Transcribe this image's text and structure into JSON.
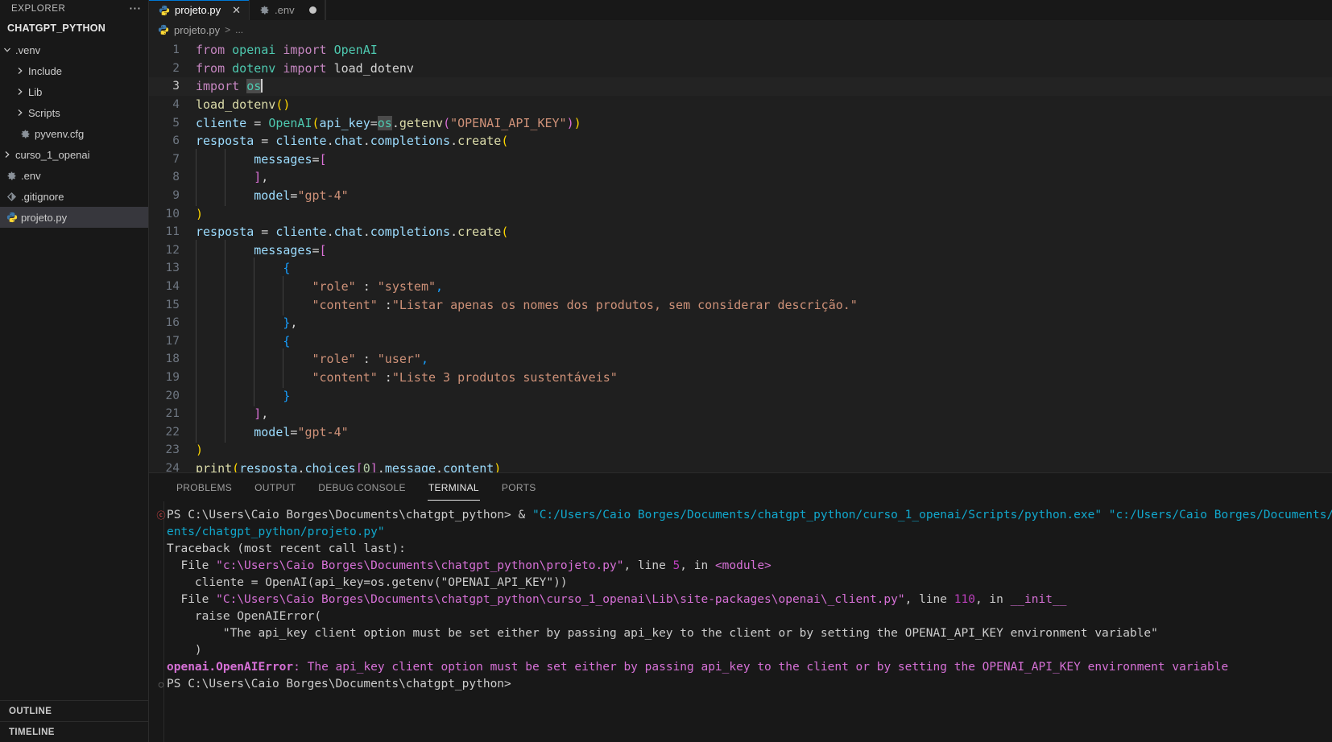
{
  "sidebar": {
    "header_title": "EXPLORER",
    "more_icon": "ellipsis-icon",
    "root_folder": "CHATGPT_PYTHON",
    "items": [
      {
        "label": ".venv",
        "type": "folder",
        "expanded": true,
        "indent": 0,
        "icon": "chevron-down-icon"
      },
      {
        "label": "Include",
        "type": "folder",
        "expanded": false,
        "indent": 1,
        "icon": "chevron-right-icon"
      },
      {
        "label": "Lib",
        "type": "folder",
        "expanded": false,
        "indent": 1,
        "icon": "chevron-right-icon"
      },
      {
        "label": "Scripts",
        "type": "folder",
        "expanded": false,
        "indent": 1,
        "icon": "chevron-right-icon"
      },
      {
        "label": "pyvenv.cfg",
        "type": "file",
        "indent": 1,
        "icon": "gear-icon"
      },
      {
        "label": "curso_1_openai",
        "type": "folder",
        "expanded": false,
        "indent": 0,
        "icon": "chevron-right-icon"
      },
      {
        "label": ".env",
        "type": "file",
        "indent": 0,
        "icon": "gear-icon"
      },
      {
        "label": ".gitignore",
        "type": "file",
        "indent": 0,
        "icon": "git-icon"
      },
      {
        "label": "projeto.py",
        "type": "file",
        "indent": 0,
        "icon": "python-icon",
        "selected": true
      }
    ],
    "bottom_sections": [
      {
        "label": "OUTLINE"
      },
      {
        "label": "TIMELINE"
      }
    ]
  },
  "tabs": [
    {
      "label": "projeto.py",
      "icon": "python-icon",
      "active": true,
      "close_icon": "close-icon"
    },
    {
      "label": ".env",
      "icon": "gear-icon",
      "active": false,
      "dirty_icon": "dirty-dot-icon"
    }
  ],
  "breadcrumb": {
    "file": "projeto.py",
    "separator": ">",
    "tail": "...",
    "icon": "python-icon"
  },
  "editor": {
    "active_line": 3,
    "cursor_line": 3,
    "lines": [
      {
        "n": 1,
        "text": "from openai import OpenAI"
      },
      {
        "n": 2,
        "text": "from dotenv import load_dotenv"
      },
      {
        "n": 3,
        "text": "import os"
      },
      {
        "n": 4,
        "text": "load_dotenv()"
      },
      {
        "n": 5,
        "text": "cliente = OpenAI(api_key=os.getenv(\"OPENAI_API_KEY\"))"
      },
      {
        "n": 6,
        "text": "resposta = cliente.chat.completions.create("
      },
      {
        "n": 7,
        "text": "        messages=["
      },
      {
        "n": 8,
        "text": "        ],"
      },
      {
        "n": 9,
        "text": "        model=\"gpt-4\""
      },
      {
        "n": 10,
        "text": ")"
      },
      {
        "n": 11,
        "text": "resposta = cliente.chat.completions.create("
      },
      {
        "n": 12,
        "text": "        messages=["
      },
      {
        "n": 13,
        "text": "            {"
      },
      {
        "n": 14,
        "text": "                \"role\" : \"system\","
      },
      {
        "n": 15,
        "text": "                \"content\" :\"Listar apenas os nomes dos produtos, sem considerar descrição.\""
      },
      {
        "n": 16,
        "text": "            },"
      },
      {
        "n": 17,
        "text": "            {"
      },
      {
        "n": 18,
        "text": "                \"role\" : \"user\","
      },
      {
        "n": 19,
        "text": "                \"content\" :\"Liste 3 produtos sustentáveis\""
      },
      {
        "n": 20,
        "text": "            }"
      },
      {
        "n": 21,
        "text": "        ],"
      },
      {
        "n": 22,
        "text": "        model=\"gpt-4\""
      },
      {
        "n": 23,
        "text": ")"
      },
      {
        "n": 24,
        "text": "print(resposta.choices[0].message.content)"
      }
    ]
  },
  "panel": {
    "tabs": [
      {
        "label": "PROBLEMS",
        "active": false
      },
      {
        "label": "OUTPUT",
        "active": false
      },
      {
        "label": "DEBUG CONSOLE",
        "active": false
      },
      {
        "label": "TERMINAL",
        "active": true
      },
      {
        "label": "PORTS",
        "active": false
      }
    ],
    "terminal": {
      "prompt_1": "PS C:\\Users\\Caio Borges\\Documents\\chatgpt_python>",
      "command_amp": " & ",
      "command_python": "\"C:/Users/Caio Borges/Documents/chatgpt_python/curso_1_openai/Scripts/python.exe\"",
      "command_script": " \"c:/Users/Caio Borges/Documents/chatgpt_python/projeto.py\"",
      "traceback_header": "Traceback (most recent call last):",
      "file1_prefix": "  File ",
      "file1_path": "\"c:\\Users\\Caio Borges\\Documents\\chatgpt_python\\projeto.py\"",
      "file1_lineinfo": ", line ",
      "file1_lineno": "5",
      "file1_in": ", in ",
      "file1_scope": "<module>",
      "file1_code": "    cliente = OpenAI(api_key=os.getenv(\"OPENAI_API_KEY\"))",
      "file2_prefix": "  File ",
      "file2_path": "\"C:\\Users\\Caio Borges\\Documents\\chatgpt_python\\curso_1_openai\\Lib\\site-packages\\openai\\_client.py\"",
      "file2_lineinfo": ", line ",
      "file2_lineno": "110",
      "file2_in": ", in ",
      "file2_scope": "__init__",
      "raise_line": "    raise OpenAIError(",
      "message_line": "        \"The api_key client option must be set either by passing api_key to the client or by setting the OPENAI_API_KEY environment variable\"",
      "close_paren": "    )",
      "error_name": "openai.OpenAIError",
      "error_colon": ": ",
      "error_message": "The api_key client option must be set either by passing api_key to the client or by setting the OPENAI_API_KEY environment variable",
      "prompt_2": "PS C:\\Users\\Caio Borges\\Documents\\chatgpt_python>",
      "gutter_error_icon": "error-circle-icon",
      "gutter_ok_icon": "success-circle-icon"
    }
  },
  "colors": {
    "accent": "#0078d4",
    "editor_bg": "#1f1f1f",
    "sidebar_bg": "#181818",
    "selection": "#37373d",
    "error": "#f14c4c",
    "terminal_cyan": "#11a8cd",
    "terminal_magenta": "#bc3fbc"
  }
}
